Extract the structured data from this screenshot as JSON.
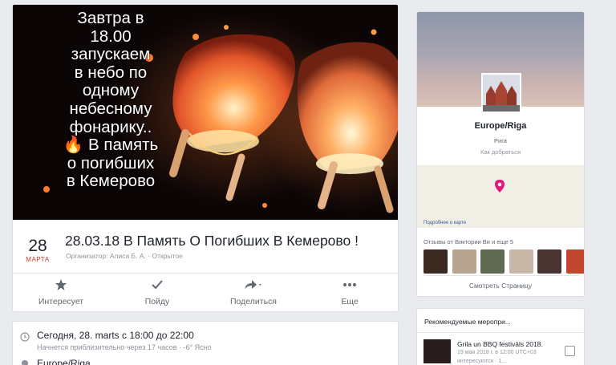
{
  "event": {
    "cover_text": [
      "Завтра в",
      "18.00",
      "запускаем",
      "в небо по",
      "одному",
      "небесному",
      "фонарику..",
      "🔥 В память",
      "о погибших",
      "в Кемерово"
    ],
    "date_day": "28",
    "date_month": "МАРТА",
    "title": "28.03.18 В Память О Погибших В Кемерово !",
    "organizer": "Организатор: Алиса Б. А. · Открытое",
    "actions": [
      {
        "label": "Интересует",
        "icon": "star-icon"
      },
      {
        "label": "Пойду",
        "icon": "checkmark-icon"
      },
      {
        "label": "Поделиться",
        "icon": "share-arrow-icon"
      },
      {
        "label": "Еще",
        "icon": "more-dots-icon"
      }
    ]
  },
  "details": {
    "time": "Сегодня, 28. marts с 18:00 до 22:00",
    "time_sub": "Начнется приблизительно через 17 часов · -6° Ясно",
    "place": "Europe/Riga"
  },
  "page": {
    "name": "Europe/Riga",
    "city": "Рига",
    "directions": "Как добраться",
    "map_link": "Подробнее о карте",
    "reviews_label": "Отзывы от Виктории Ви и еще 5",
    "see_page": "Смотреть Страницу"
  },
  "recommended": {
    "title": "Рекомендуемые меропри...",
    "event_title": "Grila un BBQ festivāls 2018.",
    "event_date": "19 мая 2018 г. в 12:00 UTC+03",
    "interested": "интересуются · 1..."
  },
  "colors": {
    "accent_month": "#c0392b",
    "map_pin": "#e0197b",
    "background": "#e9ebee"
  }
}
